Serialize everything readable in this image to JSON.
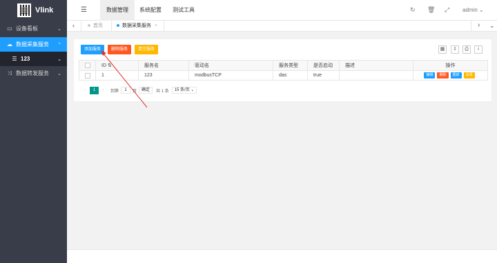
{
  "app": {
    "name": "Vlink"
  },
  "sidebar": {
    "items": [
      {
        "label": "设备看板",
        "icon": "monitor-icon"
      },
      {
        "label": "数据采集服务",
        "icon": "cloud-icon"
      },
      {
        "label": "123",
        "icon": "list-icon"
      },
      {
        "label": "数据转发服务",
        "icon": "shuffle-icon"
      }
    ]
  },
  "header": {
    "tabs": [
      "数据管理",
      "系统配置",
      "测试工具"
    ],
    "user": "admin"
  },
  "pagetabs": {
    "home": "首页",
    "current": "数据采集服务"
  },
  "toolbar": {
    "add": "添加服务",
    "delete": "删除服务",
    "clear": "清空服务"
  },
  "table": {
    "headers": [
      "ID",
      "服务名",
      "驱动名",
      "服务类型",
      "是否启动",
      "描述",
      "操作"
    ],
    "rows": [
      {
        "id": "1",
        "name": "123",
        "driver": "modbusTCP",
        "type": "das",
        "enabled": "true",
        "desc": ""
      }
    ],
    "row_actions": [
      "编辑",
      "删除",
      "重启",
      "关闭"
    ]
  },
  "pager": {
    "current": "1",
    "goto_label": "到第",
    "page_input": "1",
    "page_suffix": "页",
    "confirm": "确定",
    "total": "共 1 条",
    "page_size": "15 条/页"
  },
  "colors": {
    "sidebar": "#393d49",
    "active": "#1e9fff",
    "danger": "#ff5722",
    "warn": "#ffb800",
    "annotation": "#e0322b"
  }
}
